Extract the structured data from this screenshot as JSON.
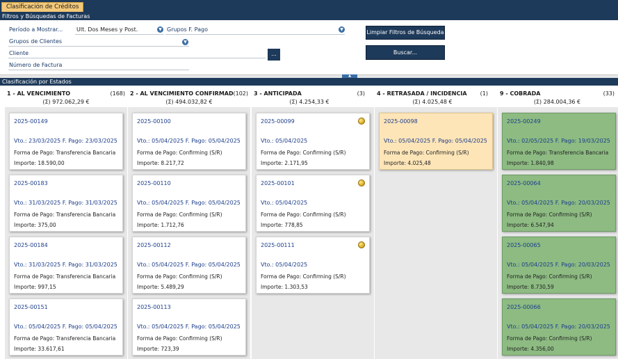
{
  "tab": {
    "label": "Clasificación de Créditos"
  },
  "filters": {
    "header": "Filtros y Búsquedas de Facturas",
    "periodo_label": "Período a Mostrar...",
    "periodo_value": "Ult. Dos Meses y Post.",
    "grupos_pago_label": "Grupos F. Pago",
    "grupos_clientes_label": "Grupos de Clientes",
    "cliente_label": "Cliente",
    "cliente_button": "...",
    "numero_factura_label": "Número de Factura",
    "clear_button": "Limpiar Filtros de Búsqueda",
    "search_button": "Buscar..."
  },
  "board": {
    "header": "Clasificación por Estados",
    "columns": [
      {
        "title": "1 - AL VENCIMIENTO",
        "count": "(168)",
        "total": "(Σ)  972.062,29  €",
        "cards": [
          {
            "id": "2025-00149",
            "dates": "Vto.: 23/03/2025   F. Pago: 23/03/2025",
            "fp": "Forma de Pago: Transferencia Bancaria",
            "imp": "Importe: 18.590,00"
          },
          {
            "id": "2025-00183",
            "dates": "Vto.: 31/03/2025   F. Pago: 31/03/2025",
            "fp": "Forma de Pago: Transferencia Bancaria",
            "imp": "Importe: 375,00"
          },
          {
            "id": "2025-00184",
            "dates": "Vto.: 31/03/2025   F. Pago: 31/03/2025",
            "fp": "Forma de Pago: Transferencia Bancaria",
            "imp": "Importe: 997,15"
          },
          {
            "id": "2025-00151",
            "dates": "Vto.: 05/04/2025   F. Pago: 05/04/2025",
            "fp": "Forma de Pago: Transferencia Bancaria",
            "imp": "Importe: 33.617,61"
          }
        ]
      },
      {
        "title": "2 - AL VENCIMIENTO CONFIRMAD",
        "count": "(102)",
        "total": "(Σ)  494.032,82  €",
        "cards": [
          {
            "id": "2025-00100",
            "dates": "Vto.: 05/04/2025   F. Pago: 05/04/2025",
            "fp": "Forma de Pago: Confirming (S/R)",
            "imp": "Importe: 8.217,72"
          },
          {
            "id": "2025-00110",
            "dates": "Vto.: 05/04/2025   F. Pago: 05/04/2025",
            "fp": "Forma de Pago: Confirming (S/R)",
            "imp": "Importe: 1.712,76"
          },
          {
            "id": "2025-00112",
            "dates": "Vto.: 05/04/2025   F. Pago: 05/04/2025",
            "fp": "Forma de Pago: Confirming (S/R)",
            "imp": "Importe: 5.489,29"
          },
          {
            "id": "2025-00113",
            "dates": "Vto.: 05/04/2025   F. Pago: 05/04/2025",
            "fp": "Forma de Pago: Confirming (S/R)",
            "imp": "Importe: 723,39"
          }
        ]
      },
      {
        "title": "3 - ANTICIPADA",
        "count": "(3)",
        "total": "(Σ)  4.254,33  €",
        "cards": [
          {
            "id": "2025-00099",
            "dates": "Vto.: 05/04/2025",
            "fp": "Forma de Pago: Confirming (S/R)",
            "imp": "Importe: 2.171,95"
          },
          {
            "id": "2025-00101",
            "dates": "Vto.: 05/04/2025",
            "fp": "Forma de Pago: Confirming (S/R)",
            "imp": "Importe: 778,85"
          },
          {
            "id": "2025-00111",
            "dates": "Vto.: 05/04/2025",
            "fp": "Forma de Pago: Confirming (S/R)",
            "imp": "Importe: 1.303,53"
          }
        ]
      },
      {
        "title": "4 - RETRASADA / INCIDENCIA",
        "count": "(1)",
        "total": "(Σ)  4.025,48  €",
        "cards": [
          {
            "id": "2025-00098",
            "dates": "Vto.: 05/04/2025   F. Pago: 05/04/2025",
            "fp": "Forma de Pago: Confirming (S/R)",
            "imp": "Importe: 4.025,48"
          }
        ]
      },
      {
        "title": "9 - COBRADA",
        "count": "(33)",
        "total": "(Σ)  284.004,36  €",
        "cards": [
          {
            "id": "2025-00249",
            "dates": "Vto.: 02/05/2025   F. Pago: 19/03/2025",
            "fp": "Forma de Pago: Transferencia Bancaria",
            "imp": "Importe: 1.840,98"
          },
          {
            "id": "2025-00064",
            "dates": "Vto.: 05/04/2025   F. Pago: 20/03/2025",
            "fp": "Forma de Pago: Confirming (S/R)",
            "imp": "Importe: 6.547,94"
          },
          {
            "id": "2025-00065",
            "dates": "Vto.: 05/04/2025   F. Pago: 20/03/2025",
            "fp": "Forma de Pago: Confirming (S/R)",
            "imp": "Importe: 8.730,59"
          },
          {
            "id": "2025-00066",
            "dates": "Vto.: 05/04/2025   F. Pago: 20/03/2025",
            "fp": "Forma de Pago: Confirming (S/R)",
            "imp": "Importe: 4.356,00"
          }
        ]
      }
    ]
  },
  "colors": {
    "navy": "#1e3a5a",
    "tab": "#f2c97a",
    "link": "#1c3d8a",
    "card_yellow": "#fde5b8",
    "card_green": "#8dbb82"
  }
}
